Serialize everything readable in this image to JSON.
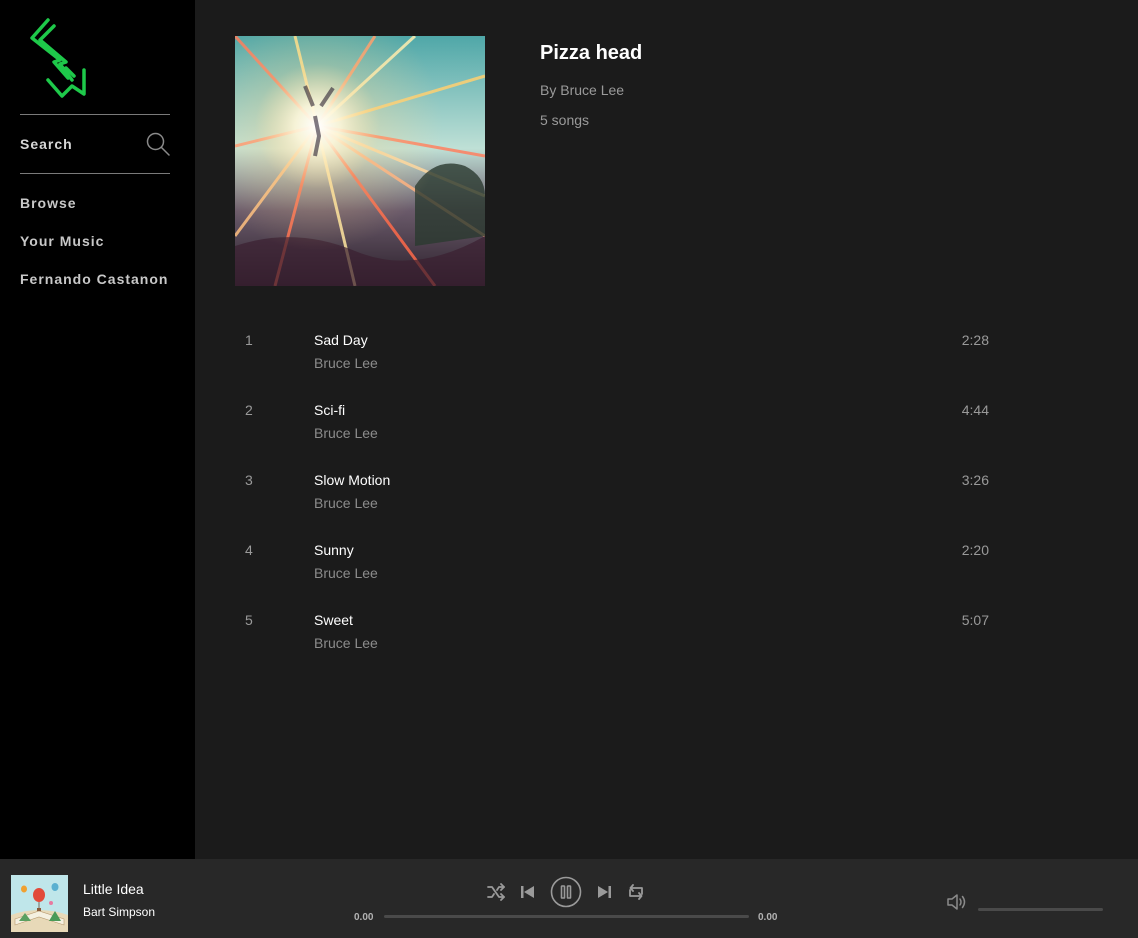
{
  "sidebar": {
    "search_label": "Search",
    "nav": [
      {
        "label": "Browse"
      },
      {
        "label": "Your Music"
      },
      {
        "label": "Fernando Castanon"
      }
    ],
    "logo_icon": "lightning-bolt-logo",
    "logo_color": "#1ec94a"
  },
  "album": {
    "title": "Pizza head",
    "artist": "By Bruce Lee",
    "song_count": "5 songs",
    "tracks": [
      {
        "num": "1",
        "title": "Sad Day",
        "artist": "Bruce Lee",
        "duration": "2:28"
      },
      {
        "num": "2",
        "title": "Sci-fi",
        "artist": "Bruce Lee",
        "duration": "4:44"
      },
      {
        "num": "3",
        "title": "Slow Motion",
        "artist": "Bruce Lee",
        "duration": "3:26"
      },
      {
        "num": "4",
        "title": "Sunny",
        "artist": "Bruce Lee",
        "duration": "2:20"
      },
      {
        "num": "5",
        "title": "Sweet",
        "artist": "Bruce Lee",
        "duration": "5:07"
      }
    ]
  },
  "player": {
    "now_playing_title": "Little Idea",
    "now_playing_artist": "Bart Simpson",
    "current_time": "0.00",
    "total_time": "0.00",
    "progress_fraction": 0,
    "volume_fraction": 0,
    "icons": [
      "shuffle-icon",
      "previous-icon",
      "pause-icon",
      "next-icon",
      "repeat-icon",
      "volume-icon"
    ]
  }
}
